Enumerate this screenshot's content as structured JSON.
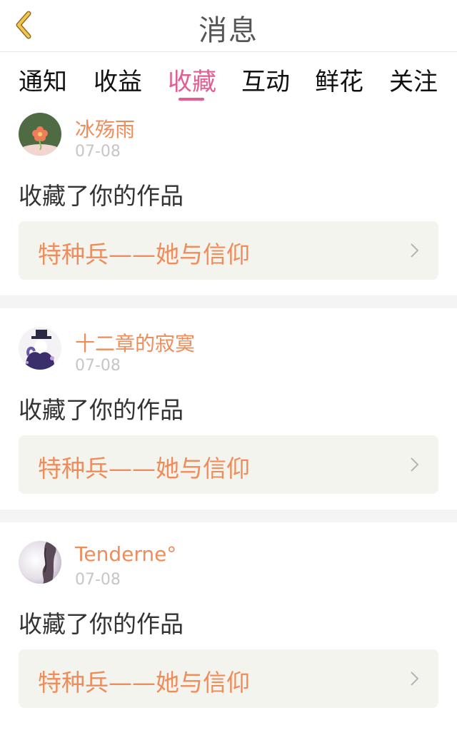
{
  "header": {
    "title": "消息",
    "back_icon": "chevron-left-icon"
  },
  "tabs": [
    {
      "label": "通知",
      "active": false
    },
    {
      "label": "收益",
      "active": false
    },
    {
      "label": "收藏",
      "active": true
    },
    {
      "label": "互动",
      "active": false
    },
    {
      "label": "鲜花",
      "active": false
    },
    {
      "label": "关注",
      "active": false
    }
  ],
  "messages": [
    {
      "username": "冰殇雨",
      "date": "07-08",
      "action": "收藏了你的作品",
      "work_title": "特种兵——她与信仰"
    },
    {
      "username": "十二章的寂寞",
      "date": "07-08",
      "action": "收藏了你的作品",
      "work_title": "特种兵——她与信仰"
    },
    {
      "username": "Tenderne°",
      "date": "07-08",
      "action": "收藏了你的作品",
      "work_title": "特种兵——她与信仰"
    }
  ],
  "colors": {
    "accent": "#e35d92",
    "username": "#ef8c5a",
    "work_box_bg": "#f4f4ef",
    "back_icon": "#e8b94a"
  }
}
